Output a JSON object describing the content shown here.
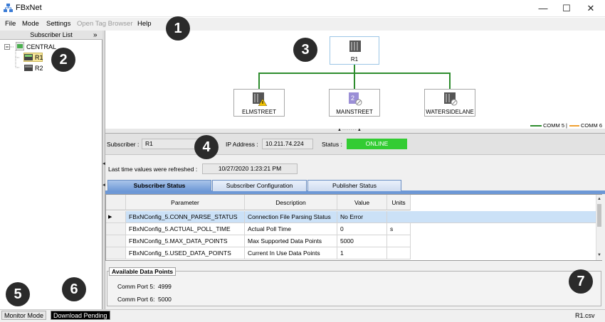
{
  "window": {
    "title": "FBxNet",
    "controls": {
      "minimize": "—",
      "maximize": "☐",
      "close": "✕"
    }
  },
  "menu": [
    "File",
    "Mode",
    "Settings",
    "Open Tag Browser",
    "Help"
  ],
  "badges": [
    "1",
    "2",
    "3",
    "4",
    "5",
    "6",
    "7"
  ],
  "subscriber_list": {
    "header": "Subscriber List",
    "collapse_glyph": "»",
    "root": "CENTRAL",
    "items": [
      "R1",
      "R2"
    ]
  },
  "diagram": {
    "root": "R1",
    "children": [
      "ELMSTREET",
      "MAINSTREET",
      "WATERSIDELANE"
    ],
    "legend": {
      "comm5": "COMM 5",
      "separator": "|",
      "comm6": "COMM 6",
      "comm5_color": "#2d8c2d",
      "comm6_color": "#f0a030"
    }
  },
  "subscriber_info": {
    "subscriber_label": "Subscriber :",
    "subscriber_value": "R1",
    "ip_label": "IP Address :",
    "ip_value": "10.211.74.224",
    "status_label": "Status :",
    "status_value": "ONLINE",
    "status_color": "#33cc33",
    "refresh_label": "Last time values were refreshed :",
    "refresh_value": "10/27/2020 1:23:21 PM"
  },
  "tabs": [
    "Subscriber Status",
    "Subscriber Configuration",
    "Publisher Status"
  ],
  "table": {
    "columns": [
      "Parameter",
      "Description",
      "Value",
      "Units"
    ],
    "rows": [
      [
        "FBxNConfig_5.CONN_PARSE_STATUS",
        "Connection File Parsing Status",
        "No Error",
        ""
      ],
      [
        "FBxNConfig_5.ACTUAL_POLL_TIME",
        "Actual Poll Time",
        "0",
        "s"
      ],
      [
        "FBxNConfig_5.MAX_DATA_POINTS",
        "Max Supported Data Points",
        "5000",
        ""
      ],
      [
        "FBxNConfig_5.USED_DATA_POINTS",
        "Current In Use Data Points",
        "1",
        ""
      ]
    ],
    "row_marker": "▶"
  },
  "available_data_points": {
    "title": "Available Data Points",
    "items": [
      {
        "label": "Comm Port 5:",
        "value": "4999"
      },
      {
        "label": "Comm Port 6:",
        "value": "5000"
      }
    ]
  },
  "statusbar": {
    "mode": "Monitor Mode",
    "pending": "Download Pending",
    "file": "R1.csv"
  }
}
